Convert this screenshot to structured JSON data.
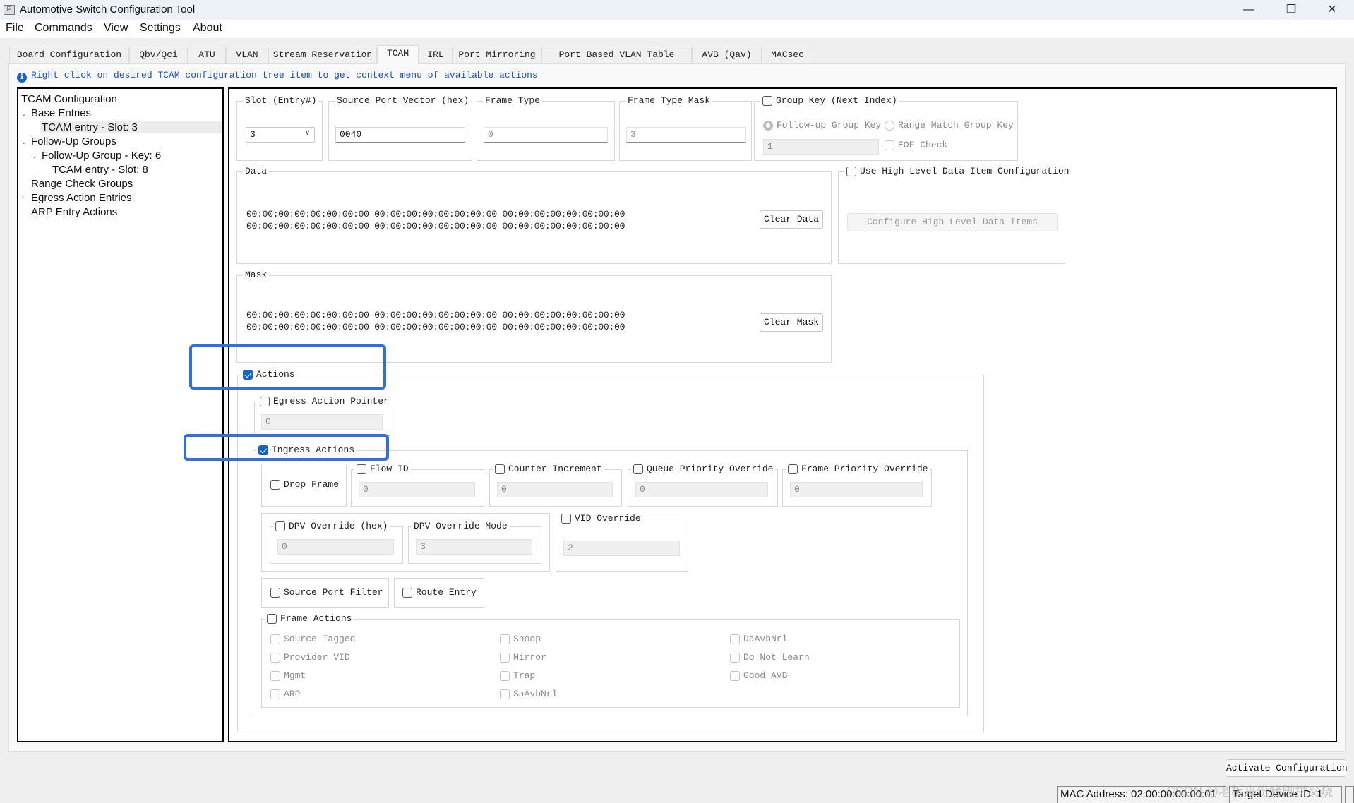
{
  "window": {
    "title": "Automotive Switch Configuration Tool",
    "icon": "app-logo-icon",
    "controls": [
      "minimize-icon",
      "restore-icon",
      "close-icon"
    ],
    "control_glyphs": {
      "minimize": "—",
      "restore": "❐",
      "close": "✕"
    }
  },
  "menu": [
    "File",
    "Commands",
    "View",
    "Settings",
    "About"
  ],
  "tabs": [
    {
      "label": "Board Configuration"
    },
    {
      "label": "Qbv/Qci"
    },
    {
      "label": "ATU"
    },
    {
      "label": "VLAN"
    },
    {
      "label": "Stream Reservation"
    },
    {
      "label": "TCAM",
      "active": true
    },
    {
      "label": "IRL"
    },
    {
      "label": "Port Mirroring"
    },
    {
      "label": "Port Based VLAN Table"
    },
    {
      "label": "AVB (Qav)"
    },
    {
      "label": "MACsec"
    }
  ],
  "hint": {
    "icon": "info-icon",
    "glyph": "i",
    "text": "Right click on desired TCAM configuration tree item to get context menu of available actions"
  },
  "tree": {
    "root": "TCAM Configuration",
    "items": [
      {
        "label": "Base Entries",
        "toggle": "⌄"
      },
      {
        "label": "TCAM entry - Slot: 3",
        "selected": true
      },
      {
        "label": "Follow-Up Groups",
        "toggle": "⌄"
      },
      {
        "label": "Follow-Up Group - Key: 6",
        "toggle": "⌄"
      },
      {
        "label": "TCAM entry - Slot: 8"
      },
      {
        "label": "Range Check Groups"
      },
      {
        "label": "Egress Action Entries",
        "toggle": "›"
      },
      {
        "label": "ARP Entry Actions"
      }
    ]
  },
  "form": {
    "slot": {
      "label": "Slot (Entry#)",
      "value": "3",
      "chevron": "∨"
    },
    "source_port_vector": {
      "label": "Source Port Vector (hex)",
      "value": "0040"
    },
    "frame_type": {
      "label": "Frame Type",
      "value": "0"
    },
    "frame_type_mask": {
      "label": "Frame Type Mask",
      "value": "3"
    },
    "group_key": {
      "label": "Group Key (Next Index)",
      "checked": false,
      "radio_followup": "Follow-up Group Key",
      "radio_range": "Range Match Group Key",
      "value": "1",
      "eof_check": "EOF Check"
    },
    "data": {
      "label": "Data",
      "lines": [
        "00:00:00:00:00:00:00:00 00:00:00:00:00:00:00:00 00:00:00:00:00:00:00:00",
        "00:00:00:00:00:00:00:00 00:00:00:00:00:00:00:00 00:00:00:00:00:00:00:00"
      ],
      "clear_button": "Clear Data"
    },
    "high_level": {
      "label": "Use High Level Data Item Configuration",
      "checked": false,
      "button": "Configure High Level Data Items"
    },
    "mask": {
      "label": "Mask",
      "lines": [
        "00:00:00:00:00:00:00:00 00:00:00:00:00:00:00:00 00:00:00:00:00:00:00:00",
        "00:00:00:00:00:00:00:00 00:00:00:00:00:00:00:00 00:00:00:00:00:00:00:00"
      ],
      "clear_button": "Clear Mask"
    },
    "actions": {
      "label": "Actions",
      "checked": true,
      "egress": {
        "label": "Egress Action Pointer",
        "checked": false,
        "value": "0"
      },
      "ingress": {
        "label": "Ingress Actions",
        "checked": true,
        "drop_frame": "Drop Frame",
        "flow_id": {
          "label": "Flow ID",
          "value": "0"
        },
        "counter_increment": {
          "label": "Counter Increment",
          "value": "0"
        },
        "queue_priority_override": {
          "label": "Queue Priority Override",
          "value": "0"
        },
        "frame_priority_override": {
          "label": "Frame Priority Override",
          "value": "0"
        },
        "dpv_override": {
          "label": "DPV Override (hex)",
          "value": "0"
        },
        "dpv_override_mode": {
          "label": "DPV Override Mode",
          "value": "3"
        },
        "vid_override": {
          "label": "VID Override",
          "value": "2"
        },
        "source_port_filter": "Source Port Filter",
        "route_entry": "Route Entry",
        "frame_actions": {
          "label": "Frame Actions",
          "columns": [
            [
              "Source Tagged",
              "Provider VID",
              "Mgmt",
              "ARP"
            ],
            [
              "Snoop",
              "Mirror",
              "Trap",
              "SaAvbNrl"
            ],
            [
              "DaAvbNrl",
              "Do Not Learn",
              "Good AVB"
            ]
          ]
        }
      }
    }
  },
  "footer": {
    "activate_button": "Activate Configuration",
    "mac_address": "MAC Address: 02:00:00:00:00:01",
    "target_device": "Target Device ID: 1",
    "watermark": "CSDN @老板来份猪脚拼叉烧"
  },
  "colors": {
    "accent": "#1763c7",
    "highlight": "#2f6fe6",
    "hint_text": "#1a4fd0"
  }
}
